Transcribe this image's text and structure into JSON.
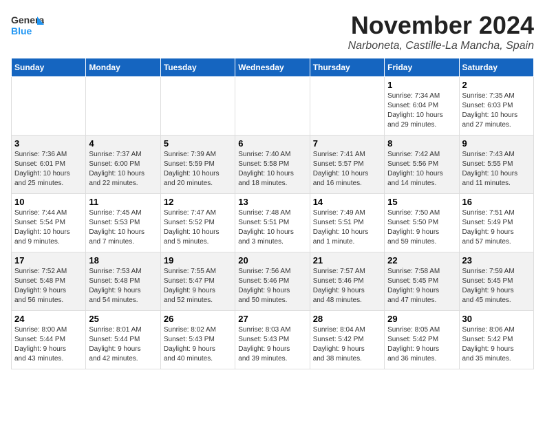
{
  "header": {
    "logo_general": "General",
    "logo_blue": "Blue",
    "month_title": "November 2024",
    "location": "Narboneta, Castille-La Mancha, Spain"
  },
  "columns": [
    "Sunday",
    "Monday",
    "Tuesday",
    "Wednesday",
    "Thursday",
    "Friday",
    "Saturday"
  ],
  "weeks": [
    [
      {
        "day": "",
        "info": ""
      },
      {
        "day": "",
        "info": ""
      },
      {
        "day": "",
        "info": ""
      },
      {
        "day": "",
        "info": ""
      },
      {
        "day": "",
        "info": ""
      },
      {
        "day": "1",
        "info": "Sunrise: 7:34 AM\nSunset: 6:04 PM\nDaylight: 10 hours\nand 29 minutes."
      },
      {
        "day": "2",
        "info": "Sunrise: 7:35 AM\nSunset: 6:03 PM\nDaylight: 10 hours\nand 27 minutes."
      }
    ],
    [
      {
        "day": "3",
        "info": "Sunrise: 7:36 AM\nSunset: 6:01 PM\nDaylight: 10 hours\nand 25 minutes."
      },
      {
        "day": "4",
        "info": "Sunrise: 7:37 AM\nSunset: 6:00 PM\nDaylight: 10 hours\nand 22 minutes."
      },
      {
        "day": "5",
        "info": "Sunrise: 7:39 AM\nSunset: 5:59 PM\nDaylight: 10 hours\nand 20 minutes."
      },
      {
        "day": "6",
        "info": "Sunrise: 7:40 AM\nSunset: 5:58 PM\nDaylight: 10 hours\nand 18 minutes."
      },
      {
        "day": "7",
        "info": "Sunrise: 7:41 AM\nSunset: 5:57 PM\nDaylight: 10 hours\nand 16 minutes."
      },
      {
        "day": "8",
        "info": "Sunrise: 7:42 AM\nSunset: 5:56 PM\nDaylight: 10 hours\nand 14 minutes."
      },
      {
        "day": "9",
        "info": "Sunrise: 7:43 AM\nSunset: 5:55 PM\nDaylight: 10 hours\nand 11 minutes."
      }
    ],
    [
      {
        "day": "10",
        "info": "Sunrise: 7:44 AM\nSunset: 5:54 PM\nDaylight: 10 hours\nand 9 minutes."
      },
      {
        "day": "11",
        "info": "Sunrise: 7:45 AM\nSunset: 5:53 PM\nDaylight: 10 hours\nand 7 minutes."
      },
      {
        "day": "12",
        "info": "Sunrise: 7:47 AM\nSunset: 5:52 PM\nDaylight: 10 hours\nand 5 minutes."
      },
      {
        "day": "13",
        "info": "Sunrise: 7:48 AM\nSunset: 5:51 PM\nDaylight: 10 hours\nand 3 minutes."
      },
      {
        "day": "14",
        "info": "Sunrise: 7:49 AM\nSunset: 5:51 PM\nDaylight: 10 hours\nand 1 minute."
      },
      {
        "day": "15",
        "info": "Sunrise: 7:50 AM\nSunset: 5:50 PM\nDaylight: 9 hours\nand 59 minutes."
      },
      {
        "day": "16",
        "info": "Sunrise: 7:51 AM\nSunset: 5:49 PM\nDaylight: 9 hours\nand 57 minutes."
      }
    ],
    [
      {
        "day": "17",
        "info": "Sunrise: 7:52 AM\nSunset: 5:48 PM\nDaylight: 9 hours\nand 56 minutes."
      },
      {
        "day": "18",
        "info": "Sunrise: 7:53 AM\nSunset: 5:48 PM\nDaylight: 9 hours\nand 54 minutes."
      },
      {
        "day": "19",
        "info": "Sunrise: 7:55 AM\nSunset: 5:47 PM\nDaylight: 9 hours\nand 52 minutes."
      },
      {
        "day": "20",
        "info": "Sunrise: 7:56 AM\nSunset: 5:46 PM\nDaylight: 9 hours\nand 50 minutes."
      },
      {
        "day": "21",
        "info": "Sunrise: 7:57 AM\nSunset: 5:46 PM\nDaylight: 9 hours\nand 48 minutes."
      },
      {
        "day": "22",
        "info": "Sunrise: 7:58 AM\nSunset: 5:45 PM\nDaylight: 9 hours\nand 47 minutes."
      },
      {
        "day": "23",
        "info": "Sunrise: 7:59 AM\nSunset: 5:45 PM\nDaylight: 9 hours\nand 45 minutes."
      }
    ],
    [
      {
        "day": "24",
        "info": "Sunrise: 8:00 AM\nSunset: 5:44 PM\nDaylight: 9 hours\nand 43 minutes."
      },
      {
        "day": "25",
        "info": "Sunrise: 8:01 AM\nSunset: 5:44 PM\nDaylight: 9 hours\nand 42 minutes."
      },
      {
        "day": "26",
        "info": "Sunrise: 8:02 AM\nSunset: 5:43 PM\nDaylight: 9 hours\nand 40 minutes."
      },
      {
        "day": "27",
        "info": "Sunrise: 8:03 AM\nSunset: 5:43 PM\nDaylight: 9 hours\nand 39 minutes."
      },
      {
        "day": "28",
        "info": "Sunrise: 8:04 AM\nSunset: 5:42 PM\nDaylight: 9 hours\nand 38 minutes."
      },
      {
        "day": "29",
        "info": "Sunrise: 8:05 AM\nSunset: 5:42 PM\nDaylight: 9 hours\nand 36 minutes."
      },
      {
        "day": "30",
        "info": "Sunrise: 8:06 AM\nSunset: 5:42 PM\nDaylight: 9 hours\nand 35 minutes."
      }
    ]
  ]
}
